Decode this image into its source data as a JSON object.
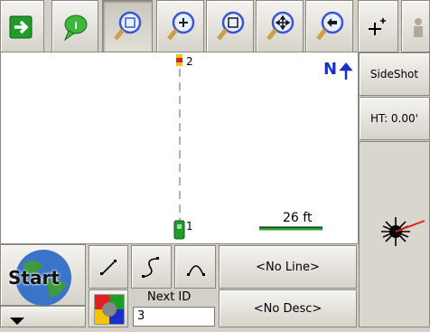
{
  "toolbar": {
    "tools": [
      {
        "icon": "arrow-right-icon"
      },
      {
        "icon": "info-balloon-icon"
      },
      {
        "icon": "zoom-extents-icon"
      },
      {
        "icon": "zoom-in-icon"
      },
      {
        "icon": "zoom-window-icon"
      },
      {
        "icon": "pan-icon"
      },
      {
        "icon": "zoom-previous-icon"
      }
    ]
  },
  "map": {
    "north_label": "N",
    "points": [
      {
        "id": "2"
      },
      {
        "id": "1"
      }
    ],
    "scale_label": "26 ft"
  },
  "side_panel": {
    "mode_label": "SideShot",
    "ht_label": "HT: 0.00'"
  },
  "bottom": {
    "start_label": "Start",
    "line_label": "<No Line>",
    "desc_label": "<No Desc>",
    "next_id_label": "Next ID",
    "next_id_value": "3"
  },
  "colors": {
    "accent_green": "#1f9d2a",
    "north_blue": "#1830c8",
    "point_red": "#e02020"
  }
}
